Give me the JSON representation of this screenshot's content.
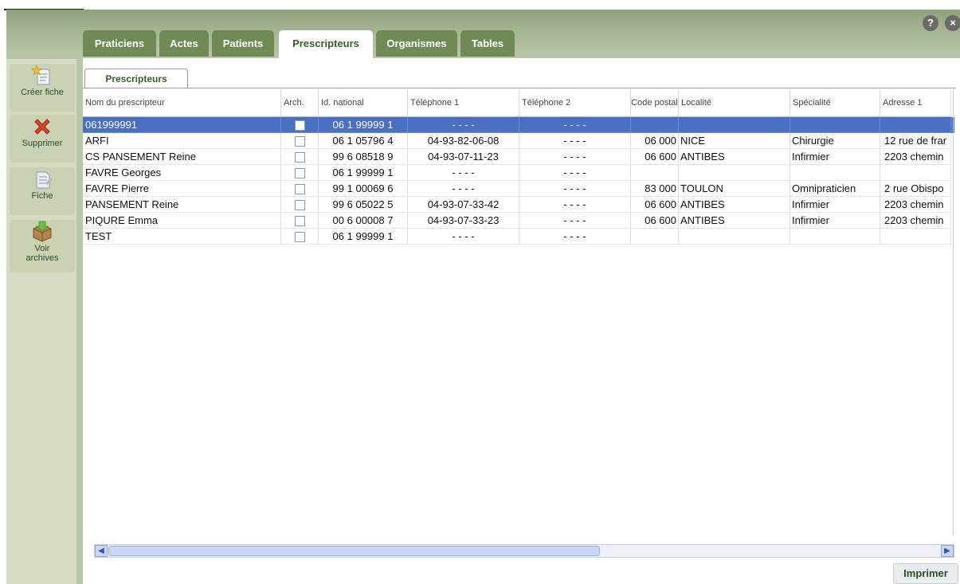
{
  "tabs": [
    "Praticiens",
    "Actes",
    "Patients",
    "Prescripteurs",
    "Organismes",
    "Tables"
  ],
  "active_tab": "Prescripteurs",
  "subtab": "Prescripteurs",
  "sidebar": [
    {
      "label": "Créer fiche",
      "icon": "new-document-star-icon"
    },
    {
      "label": "Supprimer",
      "icon": "red-cross-icon"
    },
    {
      "label": "Fiche",
      "icon": "document-icon"
    },
    {
      "label": "Voir archives",
      "icon": "archive-box-icon"
    }
  ],
  "help_icons": [
    "?",
    "×"
  ],
  "columns": [
    "Nom du prescripteur",
    "Arch.",
    "Id. national",
    "Téléphone 1",
    "Téléphone 2",
    "Code postal",
    "Localité",
    "Spécialité",
    "Adresse 1"
  ],
  "rows": [
    {
      "name": "061999991",
      "arch": false,
      "id": "06 1 99999 1",
      "tel1": "- - - -",
      "tel2": "- - - -",
      "cp": "",
      "loc": "",
      "spec": "",
      "addr": ""
    },
    {
      "name": "ARFI",
      "arch": false,
      "id": "06 1 05796 4",
      "tel1": "04-93-82-06-08",
      "tel2": "- - - -",
      "cp": "06 000",
      "loc": "NICE",
      "spec": "Chirurgie",
      "addr": "12 rue de frar"
    },
    {
      "name": "CS PANSEMENT Reine",
      "arch": false,
      "id": "99 6 08518 9",
      "tel1": "04-93-07-11-23",
      "tel2": "- - - -",
      "cp": "06 600",
      "loc": "ANTIBES",
      "spec": "Infirmier",
      "addr": "2203 chemin"
    },
    {
      "name": "FAVRE Georges",
      "arch": false,
      "id": "06 1 99999 1",
      "tel1": "- - - -",
      "tel2": "- - - -",
      "cp": "",
      "loc": "",
      "spec": "",
      "addr": ""
    },
    {
      "name": "FAVRE Pierre",
      "arch": false,
      "id": "99 1 00069 6",
      "tel1": "- - - -",
      "tel2": "- - - -",
      "cp": "83 000",
      "loc": "TOULON",
      "spec": "Omnipraticien",
      "addr": "2 rue Obispo"
    },
    {
      "name": "PANSEMENT Reine",
      "arch": false,
      "id": "99 6 05022 5",
      "tel1": "04-93-07-33-42",
      "tel2": "- - - -",
      "cp": "06 600",
      "loc": "ANTIBES",
      "spec": "Infirmier",
      "addr": "2203 chemin"
    },
    {
      "name": "PIQURE Emma",
      "arch": false,
      "id": "00 6 00008 7",
      "tel1": "04-93-07-33-23",
      "tel2": "- - - -",
      "cp": "06 600",
      "loc": "ANTIBES",
      "spec": "Infirmier",
      "addr": "2203 chemin"
    },
    {
      "name": "TEST",
      "arch": false,
      "id": "06 1 99999 1",
      "tel1": "- - - -",
      "tel2": "- - - -",
      "cp": "",
      "loc": "",
      "spec": "",
      "addr": ""
    }
  ],
  "selected_row": 0,
  "print_label": "Imprimer",
  "colors": {
    "accent": "#708a55",
    "selection": "#4b6fc4",
    "sidebar": "#d5dcc4"
  }
}
